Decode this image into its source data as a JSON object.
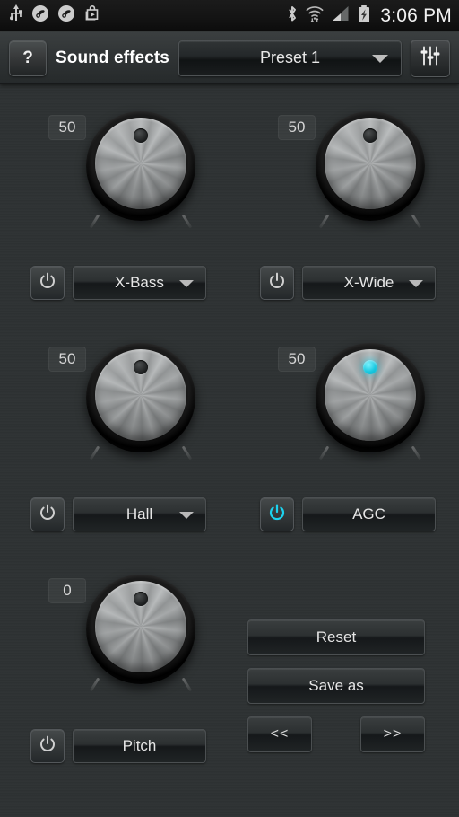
{
  "status_bar": {
    "time": "3:06 PM",
    "left_icons": [
      "usb-icon",
      "headset-audio-icon",
      "headset-audio-icon",
      "play-store-icon"
    ],
    "right_icons": [
      "bluetooth-icon",
      "wifi-icon",
      "cellular-signal-icon",
      "battery-charging-icon"
    ]
  },
  "header": {
    "help_label": "?",
    "title": "Sound effects",
    "preset_value": "Preset 1",
    "eq_icon": "equalizer-sliders-icon"
  },
  "colors": {
    "accent": "#1cd2ee",
    "background": "#2e3233",
    "text": "#e6e6e6"
  },
  "effects": [
    {
      "id": "x-bass",
      "value": "50",
      "label": "X-Bass",
      "has_dropdown": true,
      "enabled": false
    },
    {
      "id": "x-wide",
      "value": "50",
      "label": "X-Wide",
      "has_dropdown": true,
      "enabled": false
    },
    {
      "id": "hall",
      "value": "50",
      "label": "Hall",
      "has_dropdown": true,
      "enabled": false
    },
    {
      "id": "agc",
      "value": "50",
      "label": "AGC",
      "has_dropdown": false,
      "enabled": true
    },
    {
      "id": "pitch",
      "value": "0",
      "label": "Pitch",
      "has_dropdown": false,
      "enabled": false
    }
  ],
  "actions": {
    "reset_label": "Reset",
    "save_as_label": "Save as",
    "prev_label": "<<",
    "next_label": ">>"
  }
}
